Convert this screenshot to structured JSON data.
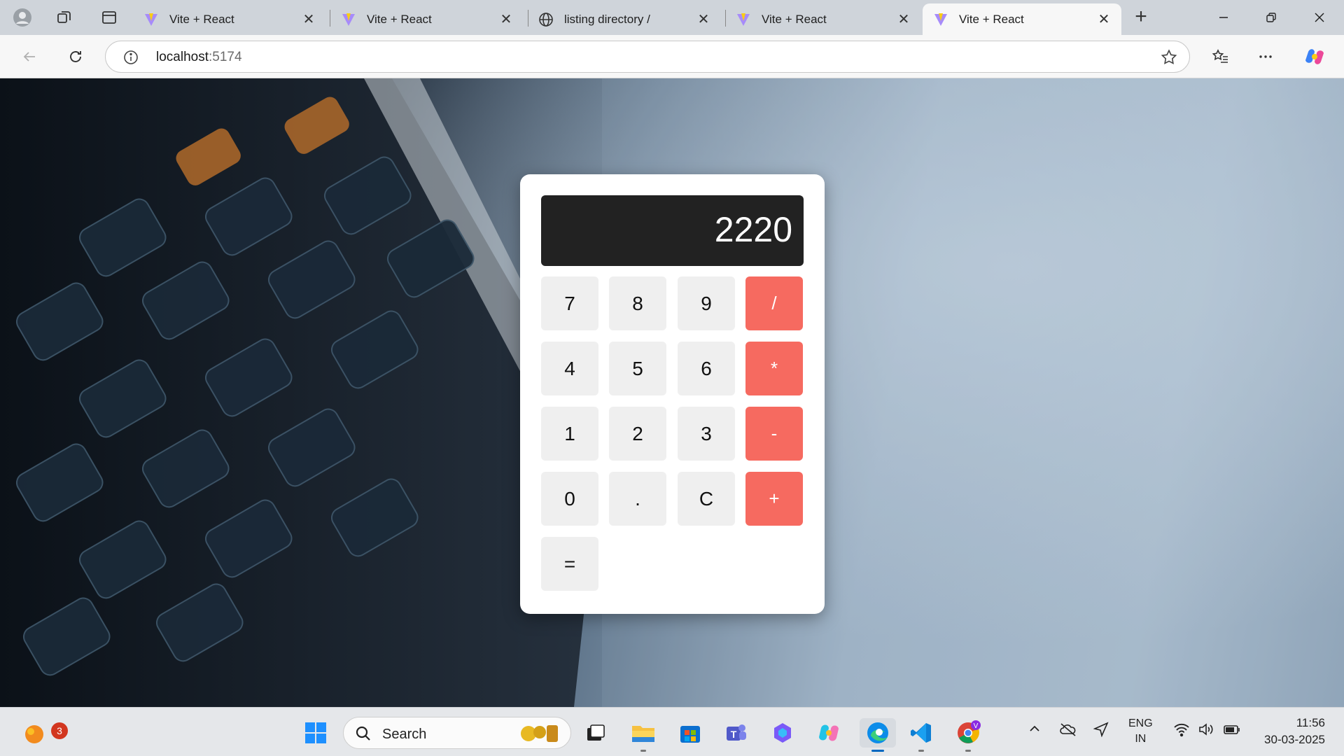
{
  "browser": {
    "tabs": [
      {
        "title": "Vite + React",
        "icon": "vite-logo-icon",
        "active": false
      },
      {
        "title": "Vite + React",
        "icon": "vite-logo-icon",
        "active": false
      },
      {
        "title": "listing directory /",
        "icon": "globe-icon",
        "active": false
      },
      {
        "title": "Vite + React",
        "icon": "vite-logo-icon",
        "active": false
      },
      {
        "title": "Vite + React",
        "icon": "vite-logo-icon",
        "active": true
      }
    ],
    "close_glyph": "✕",
    "new_tab_glyph": "+",
    "address": {
      "host": "localhost",
      "port": ":5174"
    }
  },
  "calculator": {
    "display_value": "2220",
    "keys": [
      "7",
      "8",
      "9",
      "/",
      "4",
      "5",
      "6",
      "*",
      "1",
      "2",
      "3",
      "-",
      "0",
      ".",
      "C",
      "+",
      "="
    ],
    "operator_color": "#f66a60",
    "key_color": "#efefef",
    "display_color": "#222222"
  },
  "taskbar": {
    "notification_count": "3",
    "search_label": "Search",
    "language": {
      "line1": "ENG",
      "line2": "IN"
    },
    "clock": {
      "time": "11:56",
      "date": "30-03-2025"
    },
    "accent_color": "#0067c0"
  }
}
